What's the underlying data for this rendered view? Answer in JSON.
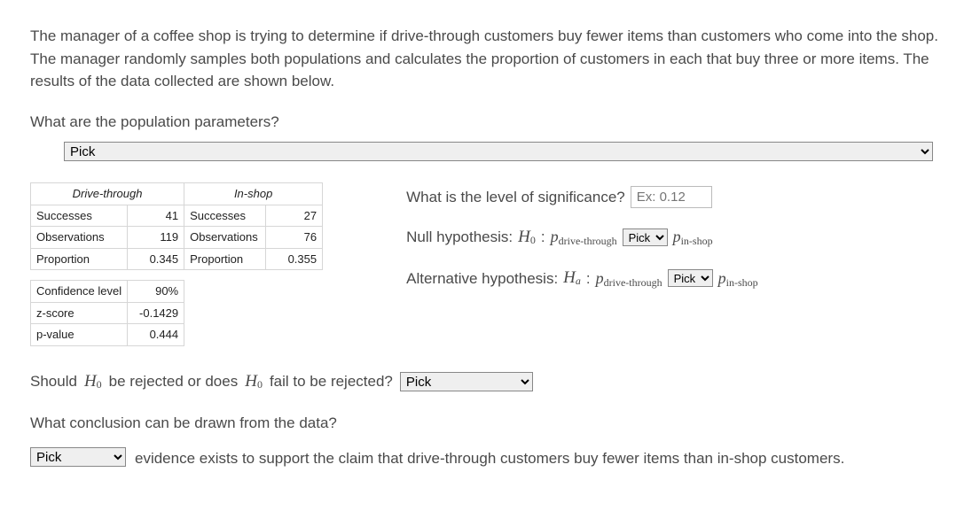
{
  "intro": "The manager of a coffee shop is trying to determine if drive-through customers buy fewer items than customers who come into the shop. The manager randomly samples both populations and calculates the proportion of customers in each that buy three or more items. The results of the data collected are shown below.",
  "q_population": "What are the population parameters?",
  "pick_label": "Pick",
  "table": {
    "col1_header": "Drive-through",
    "col2_header": "In-shop",
    "rows": [
      {
        "l1": "Successes",
        "v1": "41",
        "l2": "Successes",
        "v2": "27"
      },
      {
        "l1": "Observations",
        "v1": "119",
        "l2": "Observations",
        "v2": "76"
      },
      {
        "l1": "Proportion",
        "v1": "0.345",
        "l2": "Proportion",
        "v2": "0.355"
      }
    ],
    "stats": [
      {
        "l": "Confidence level",
        "v": "90%"
      },
      {
        "l": "z-score",
        "v": "-0.1429"
      },
      {
        "l": "p-value",
        "v": "0.444"
      }
    ]
  },
  "sig_q": "What is the level of significance?",
  "sig_placeholder": "Ex: 0.12",
  "null_label": "Null hypothesis:",
  "alt_label": "Alternative hypothesis:",
  "H0": "H",
  "Hsub0": "0",
  "Ha": "H",
  "Hsuba": "a",
  "p_drive": "p",
  "p_drive_sub": "drive-through",
  "p_in": "p",
  "p_in_sub": "in-shop",
  "reject_q_pre": "Should ",
  "reject_q_mid": " be rejected or does ",
  "reject_q_post": " fail to be rejected?",
  "conclusion_q": "What conclusion can be drawn from the data?",
  "conclusion_text": "evidence exists to support the claim that drive-through customers buy fewer items than in-shop customers."
}
